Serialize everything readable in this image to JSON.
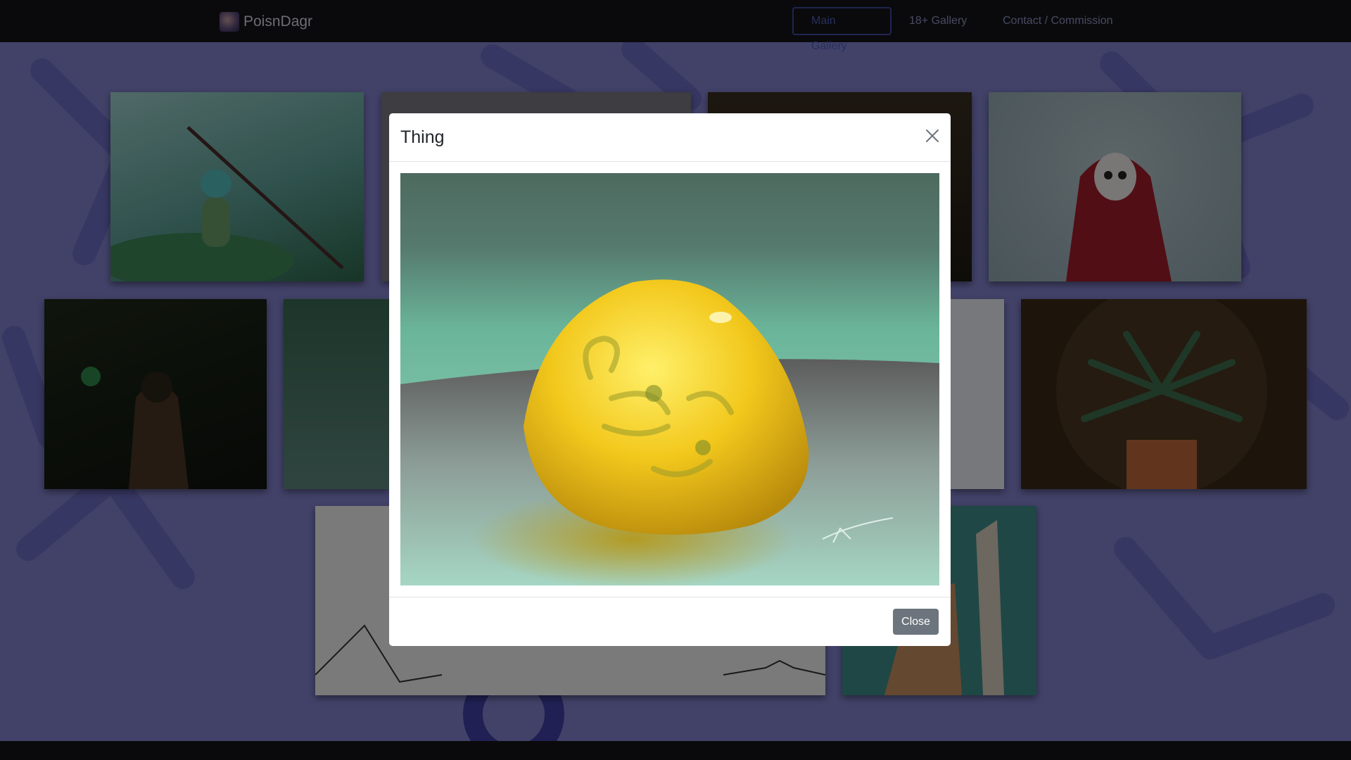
{
  "nav": {
    "brand": "PoisnDagr",
    "links": [
      {
        "label": "Main Gallery",
        "active": true
      },
      {
        "label": "18+ Gallery",
        "active": false
      },
      {
        "label": "Contact / Commission",
        "active": false
      }
    ]
  },
  "gallery": {
    "items": [
      {
        "name": "goblin-spear-art"
      },
      {
        "name": "gray-art"
      },
      {
        "name": "dark-warm-art"
      },
      {
        "name": "red-hood-mask-art"
      },
      {
        "name": "hooded-figure-art"
      },
      {
        "name": "yellow-egg-art"
      },
      {
        "name": "blue-sketch-art"
      },
      {
        "name": "fern-plant-art"
      },
      {
        "name": "mountain-lineart"
      },
      {
        "name": "beaded-arm-art"
      }
    ]
  },
  "modal": {
    "title": "Thing",
    "close_label": "Close"
  },
  "colors": {
    "navbar": "#14141a",
    "background": "#8584d2",
    "accent": "#3d4a9c",
    "button": "#6c757d"
  }
}
